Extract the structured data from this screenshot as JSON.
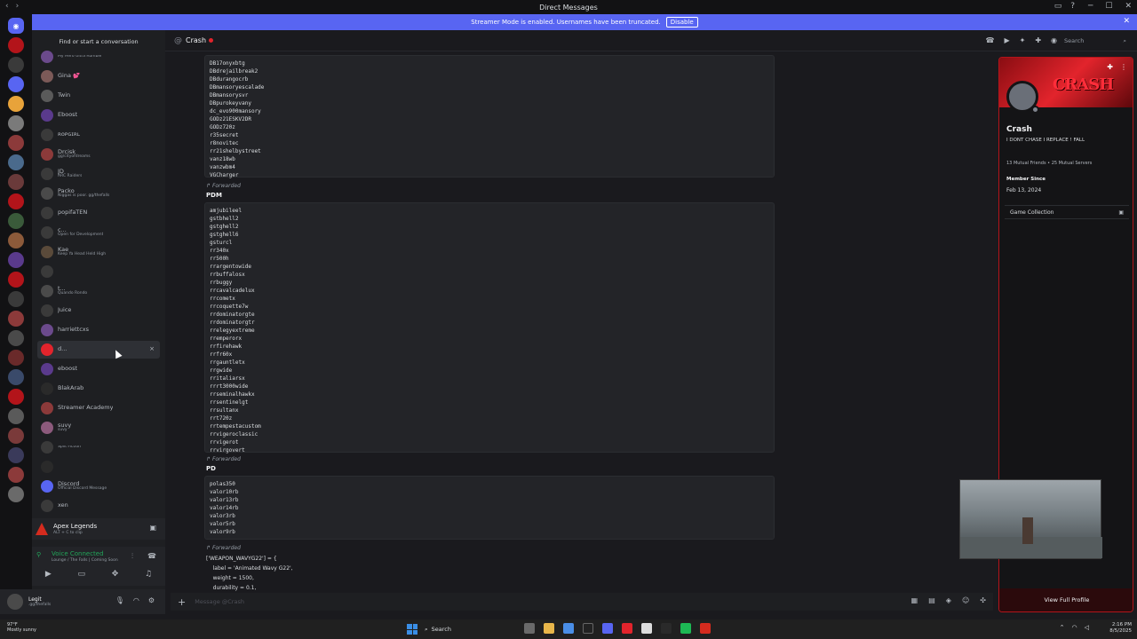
{
  "window": {
    "title": "Direct Messages"
  },
  "banner": {
    "text": "Streamer Mode is enabled. Usernames have been truncated.",
    "disable_label": "Disable"
  },
  "sidebar": {
    "search_label": "Find or start a conversation",
    "dms": [
      {
        "name": "",
        "sub": "My Hero Ultra Rumble",
        "color": "#6b4a8c"
      },
      {
        "name": "Gina 💕",
        "sub": "",
        "color": "#7c5a58"
      },
      {
        "name": "Twin",
        "sub": "",
        "color": "#5a5a5a"
      },
      {
        "name": "Eboost",
        "sub": "",
        "color": "#5a3a8c"
      },
      {
        "name": "ʀᴏᴘɢɪʀʟ",
        "sub": "",
        "color": "#3a3a3a"
      },
      {
        "name": "Drcisk",
        "sub": "gg/cityofdreams",
        "color": "#8c3a3a"
      },
      {
        "name": "JD",
        "sub": "ARC Raiders",
        "color": "#3a3a3a"
      },
      {
        "name": "Packo",
        "sub": "Niggas is poor. gg/thefalls",
        "color": "#4a4a4a"
      },
      {
        "name": "popifaTEN",
        "sub": "",
        "color": "#3a3a3a"
      },
      {
        "name": "c...",
        "sub": "Open for Development",
        "color": "#3a3a3a"
      },
      {
        "name": "Kae",
        "sub": "Keep Ya Head Held High",
        "color": "#5a4a3a"
      },
      {
        "name": "",
        "sub": "",
        "color": "#3a3a3a"
      },
      {
        "name": "t...",
        "sub": "Quando Rondo",
        "color": "#4a4a4a"
      },
      {
        "name": "Juice",
        "sub": "",
        "color": "#3a3a3a"
      },
      {
        "name": "harriettcxs",
        "sub": "",
        "color": "#6b4a8c"
      },
      {
        "name": "d...",
        "sub": "",
        "color": "#e2242c"
      },
      {
        "name": "eboost",
        "sub": "",
        "color": "#5a3a8c"
      },
      {
        "name": "BlakArab",
        "sub": "",
        "color": "#2a2a2a"
      },
      {
        "name": "Streamer Academy",
        "sub": "",
        "color": "#8c3a3a"
      },
      {
        "name": "suvy",
        "sub": "suvy",
        "color": "#8c5a7c"
      },
      {
        "name": "",
        "sub": "Split Fiction",
        "color": "#3a3a3a"
      },
      {
        "name": "",
        "sub": "",
        "color": "#2a2a2a"
      },
      {
        "name": "Discord",
        "sub": "Official Discord Message",
        "color": "#5865f2"
      },
      {
        "name": "xen",
        "sub": "",
        "color": "#3a3a3a"
      }
    ],
    "close_label": "×"
  },
  "activity": {
    "game": "Apex Legends",
    "sub": "ALT + C to clip"
  },
  "voice": {
    "status": "Voice Connected",
    "channel": "Lounge / The Falls | Coming Soon"
  },
  "user": {
    "name": "Legit",
    "sub": ".gg/thefalls"
  },
  "chat": {
    "recipient": "Crash",
    "search_placeholder": "Search",
    "composer_placeholder": "Message @Crash",
    "block1": "DB17onyxbtg\nDBdrejailbreak2\nDBdurangocrb\nDBmansoryescalade\nDBmansorysvr\nDBpurokeyvany\ndc_evo900mansory\nGODz21ESKV2DR\nGODz720z\nr35secret\nr8novitec\nrr21shelbystreet\nvanz18wb\nvanzwbm4\nVGCharger",
    "forwarded_label": "Forwarded",
    "title_pdm": "PDM",
    "block2": "amjubileel\ngstbhell2\ngstghell2\ngstghell6\ngsturcl\nrr340x\nrr500h\nrrargentowide\nrrbuffalosx\nrrbuggy\nrrcavalcadelux\nrrcometx\nrrcoquette7w\nrrdominatorgte\nrrdominatorgtr\nrrelegyextreme\nrremperorx\nrrfirehawk\nrrfr60x\nrrgauntletx\nrrgwide\nrritaliarsx\nrrrt3000wide\nrrseminalhawkx\nrrsentinelgt\nrrsultanx\nrrt720z\nrrtempestacustom\nrrvigeroclassic\nrrvigerot\nrrvirgovert",
    "title_pd": "PD",
    "block3": "polas350\nvalor10rb\nvalor13rb\nvalor14rb\nvalor3rb\nvalor5rb\nvalor9rb",
    "block4": "['WEAPON_WAVYG22'] = {\n    label = 'Animated Wavy G22',\n    weight = 1500,\n    durability = 0.1,"
  },
  "profile": {
    "name": "Crash",
    "bio": "I DONT CHASE I REPLACE !   FALL",
    "mutuals": "13 Mutual Friends • 25 Mutual Servers",
    "member_since_label": "Member Since",
    "member_since": "Feb 13, 2024",
    "game_collection": "Game Collection",
    "view_full": "View Full Profile",
    "banner_art": "CRASH"
  },
  "taskbar": {
    "temp": "97°F",
    "weather": "Mostly sunny",
    "search": "Search",
    "time": "2:16 PM",
    "date": "8/5/2025"
  },
  "colors": {
    "accent": "#5865f2",
    "profile_border": "#b3141a"
  }
}
